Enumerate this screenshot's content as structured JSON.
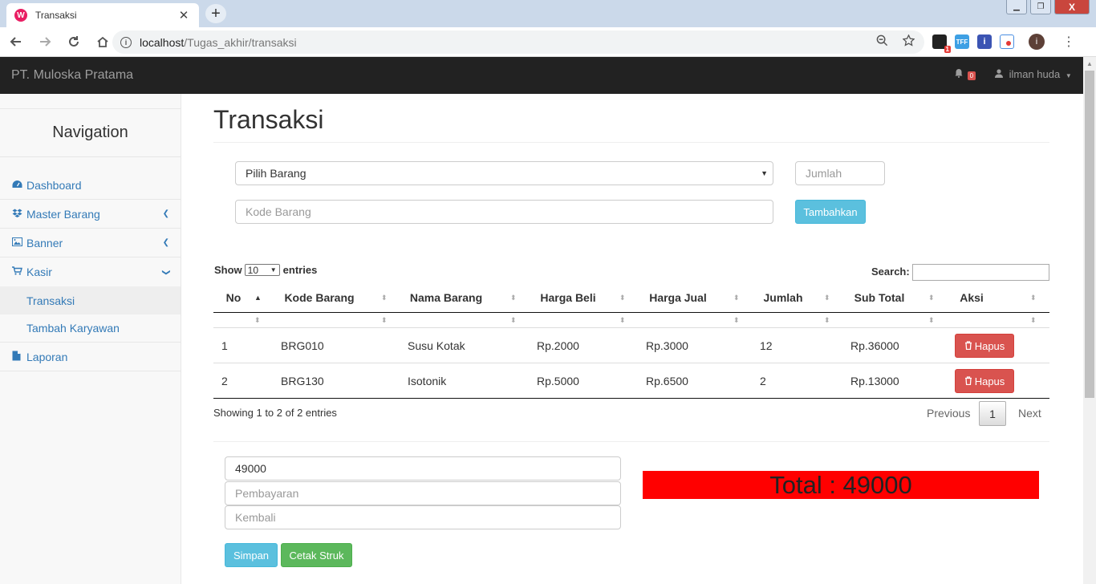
{
  "browser": {
    "tab_title": "Transaksi",
    "tab_favicon": "W",
    "tab_close": "✕",
    "new_tab": "+",
    "url_host": "localhost",
    "url_path": "/Tugas_akhir/transaksi",
    "ext_badge": "1",
    "ext_tff": "TFF",
    "ext_info": "i",
    "profile_initial": "i",
    "win_min": "▁",
    "win_max": "❐",
    "win_close": "X"
  },
  "navbar": {
    "brand": "PT. Muloska Pratama",
    "bell_count": "0",
    "user_name": "ilman huda"
  },
  "sidebar": {
    "header": "Navigation",
    "items": {
      "dashboard": "Dashboard",
      "master_barang": "Master Barang",
      "banner": "Banner",
      "kasir": "Kasir",
      "transaksi": "Transaksi",
      "tambah_karyawan": "Tambah Karyawan",
      "laporan": "Laporan"
    }
  },
  "page": {
    "title": "Transaksi"
  },
  "form": {
    "barang_select": "Pilih Barang",
    "jumlah_placeholder": "Jumlah",
    "kode_placeholder": "Kode Barang",
    "add_button": "Tambahkan"
  },
  "datatable": {
    "show_label": "Show",
    "length_value": "10",
    "entries_label": "entries",
    "search_label": "Search:",
    "columns": {
      "no": "No",
      "kode": "Kode Barang",
      "nama": "Nama Barang",
      "beli": "Harga Beli",
      "jual": "Harga Jual",
      "jumlah": "Jumlah",
      "subtotal": "Sub Total",
      "aksi": "Aksi"
    },
    "rows": [
      {
        "no": "1",
        "kode": "BRG010",
        "nama": "Susu Kotak",
        "beli": "Rp.2000",
        "jual": "Rp.3000",
        "jumlah": "12",
        "subtotal": "Rp.36000",
        "action": "Hapus"
      },
      {
        "no": "2",
        "kode": "BRG130",
        "nama": "Isotonik",
        "beli": "Rp.5000",
        "jual": "Rp.6500",
        "jumlah": "2",
        "subtotal": "Rp.13000",
        "action": "Hapus"
      }
    ],
    "info": "Showing 1 to 2 of 2 entries",
    "prev": "Previous",
    "page": "1",
    "next": "Next"
  },
  "payment": {
    "total_value": "49000",
    "pembayaran_placeholder": "Pembayaran",
    "kembali_placeholder": "Kembali",
    "save_button": "Simpan",
    "print_button": "Cetak Struk",
    "total_banner": "Total : 49000"
  },
  "colors": {
    "navbar_bg": "#222222",
    "link": "#337ab7",
    "btn_info": "#5bc0de",
    "btn_success": "#5cb85c",
    "btn_danger": "#d9534f",
    "total_bg": "#ff0000"
  }
}
